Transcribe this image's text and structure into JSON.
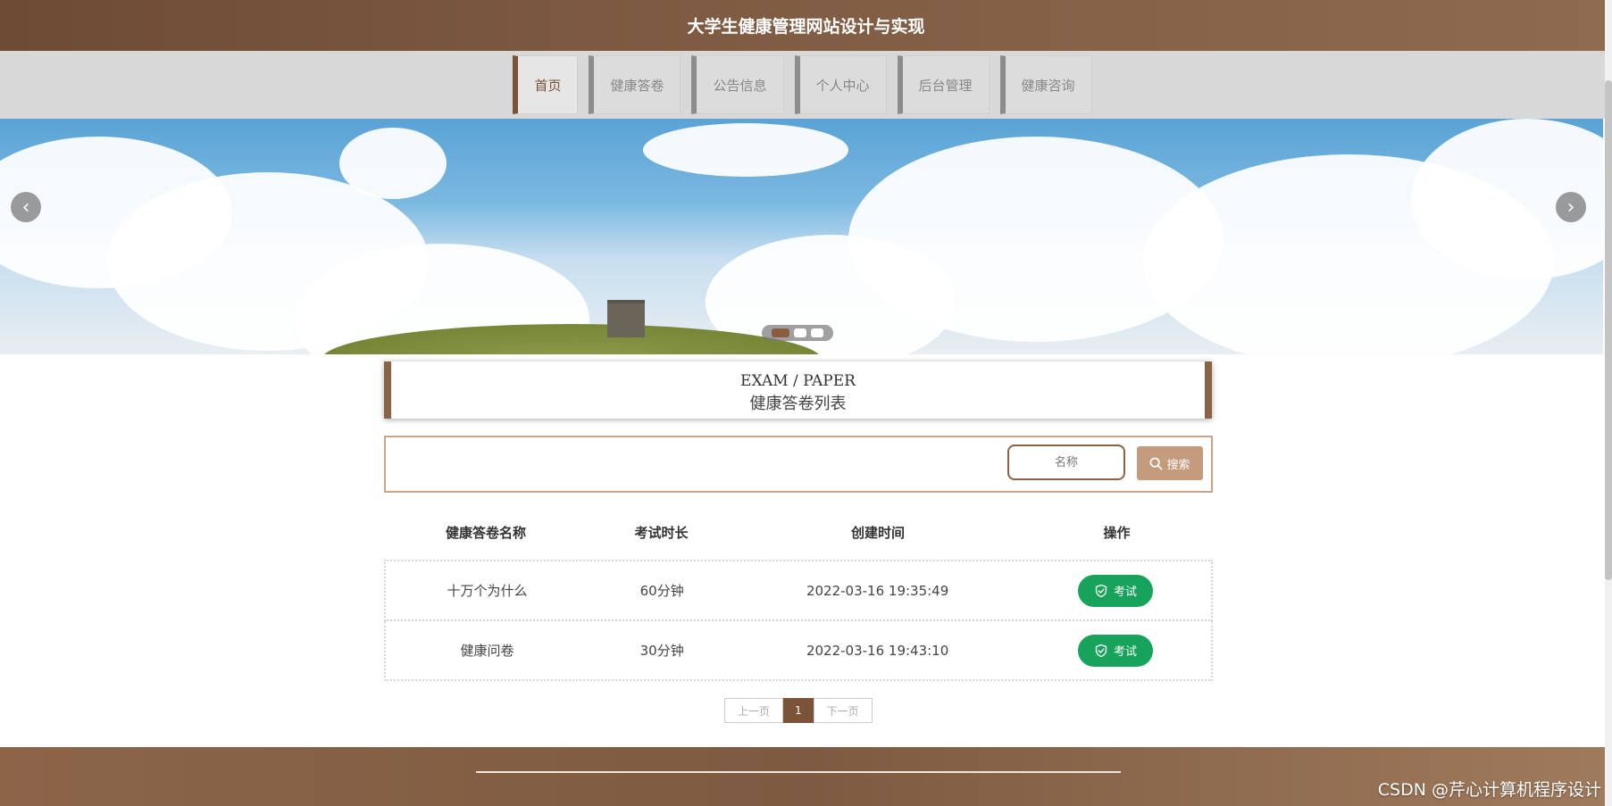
{
  "header": {
    "title": "大学生健康管理网站设计与实现"
  },
  "nav": {
    "items": [
      {
        "label": "首页",
        "active": true
      },
      {
        "label": "健康答卷",
        "active": false
      },
      {
        "label": "公告信息",
        "active": false
      },
      {
        "label": "个人中心",
        "active": false
      },
      {
        "label": "后台管理",
        "active": false
      },
      {
        "label": "健康咨询",
        "active": false
      }
    ]
  },
  "banner": {
    "active_slide": 1,
    "slide_count": 3
  },
  "section": {
    "title_en": "EXAM / PAPER",
    "title_cn": "健康答卷列表"
  },
  "search": {
    "placeholder": "名称",
    "button_label": "搜索"
  },
  "table": {
    "headers": [
      "健康答卷名称",
      "考试时长",
      "创建时间",
      "操作"
    ],
    "rows": [
      {
        "name": "十万个为什么",
        "duration": "60分钟",
        "created": "2022-03-16 19:35:49",
        "action": "考试"
      },
      {
        "name": "健康问卷",
        "duration": "30分钟",
        "created": "2022-03-16 19:43:10",
        "action": "考试"
      }
    ]
  },
  "pagination": {
    "prev": "上一页",
    "current": "1",
    "next": "下一页"
  },
  "watermark": "CSDN @芹心计算机程序设计",
  "colors": {
    "brand_brown": "#7a5339",
    "accent_tan": "#c59b7d",
    "action_green": "#17a35a"
  }
}
